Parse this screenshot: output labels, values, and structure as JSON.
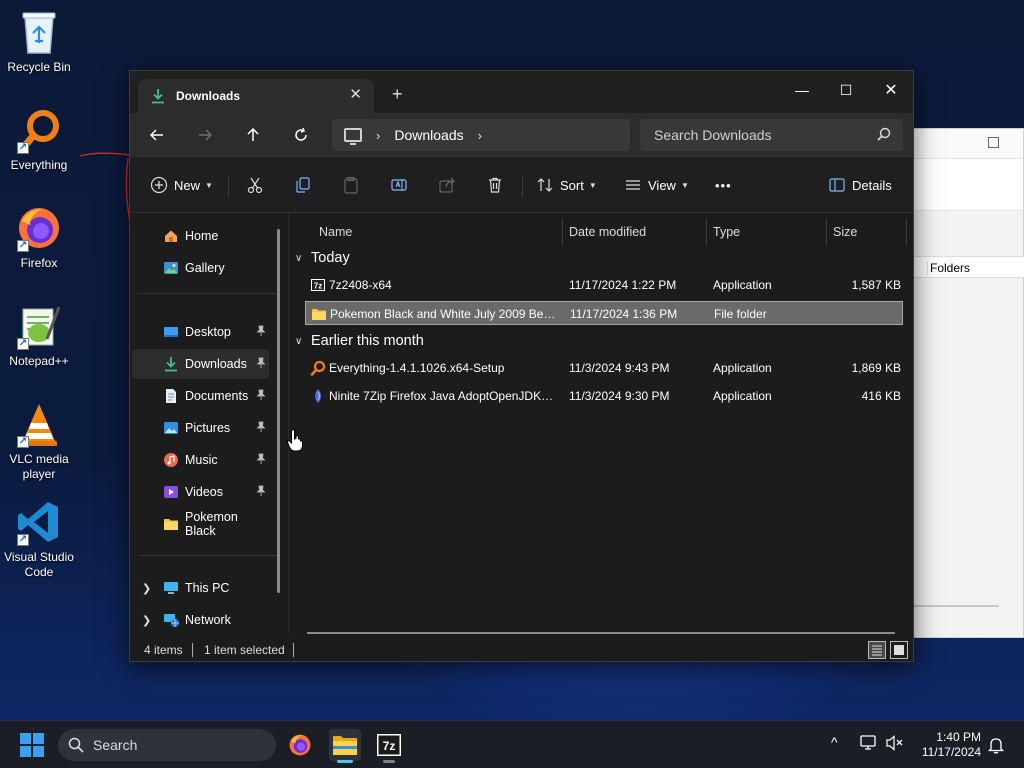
{
  "desktop": {
    "icons": [
      {
        "label": "Recycle Bin"
      },
      {
        "label": "Everything"
      },
      {
        "label": "Firefox"
      },
      {
        "label": "Notepad++"
      },
      {
        "label": "VLC media player"
      },
      {
        "label": "Visual Studio Code"
      }
    ]
  },
  "background_window": {
    "folders_label": "Folders"
  },
  "explorer": {
    "tab_title": "Downloads",
    "tab_close": "✕",
    "new_tab": "+",
    "window_controls": {
      "minimize": "—",
      "maximize": "☐",
      "close": "✕"
    },
    "breadcrumb": [
      "Downloads"
    ],
    "search_placeholder": "Search Downloads",
    "commands": {
      "new": "New",
      "sort": "Sort",
      "view": "View",
      "more": "•••",
      "details": "Details"
    },
    "sidebar": {
      "items": [
        {
          "label": "Home",
          "icon": "home-icon"
        },
        {
          "label": "Gallery",
          "icon": "gallery-icon"
        },
        {
          "label": "Desktop",
          "icon": "desktop-folder-icon",
          "pinned": true
        },
        {
          "label": "Downloads",
          "icon": "download-icon",
          "pinned": true,
          "selected": true
        },
        {
          "label": "Documents",
          "icon": "documents-icon",
          "pinned": true
        },
        {
          "label": "Pictures",
          "icon": "pictures-icon",
          "pinned": true
        },
        {
          "label": "Music",
          "icon": "music-icon",
          "pinned": true
        },
        {
          "label": "Videos",
          "icon": "videos-icon",
          "pinned": true
        },
        {
          "label": "Pokemon Black",
          "icon": "folder-icon"
        },
        {
          "label": "This PC",
          "icon": "pc-icon"
        },
        {
          "label": "Network",
          "icon": "network-icon"
        }
      ]
    },
    "columns": {
      "name": "Name",
      "date": "Date modified",
      "type": "Type",
      "size": "Size"
    },
    "groups": [
      {
        "title": "Today",
        "files": [
          {
            "name": "7z2408-x64",
            "date": "11/17/2024 1:22 PM",
            "type": "Application",
            "size": "1,587 KB",
            "icon": "7zip-icon"
          },
          {
            "name": "Pokemon Black and White July 2009 Beta...",
            "date": "11/17/2024 1:36 PM",
            "type": "File folder",
            "size": "",
            "icon": "folder-icon",
            "selected": true
          }
        ]
      },
      {
        "title": "Earlier this month",
        "files": [
          {
            "name": "Everything-1.4.1.1026.x64-Setup",
            "date": "11/3/2024 9:43 PM",
            "type": "Application",
            "size": "1,869 KB",
            "icon": "everything-icon"
          },
          {
            "name": "Ninite 7Zip Firefox Java AdoptOpenJDK x...",
            "date": "11/3/2024 9:30 PM",
            "type": "Application",
            "size": "416 KB",
            "icon": "ninite-icon"
          }
        ]
      }
    ],
    "status": {
      "count": "4 items",
      "selection": "1 item selected"
    }
  },
  "taskbar": {
    "search_label": "Search",
    "time": "1:40 PM",
    "date": "11/17/2024",
    "tray_chevron": "^"
  },
  "colors": {
    "accent": "#4cc2ff",
    "window_bg": "#1c1c1c",
    "selection": "#6a6a6a",
    "folder": "#f5c542"
  }
}
